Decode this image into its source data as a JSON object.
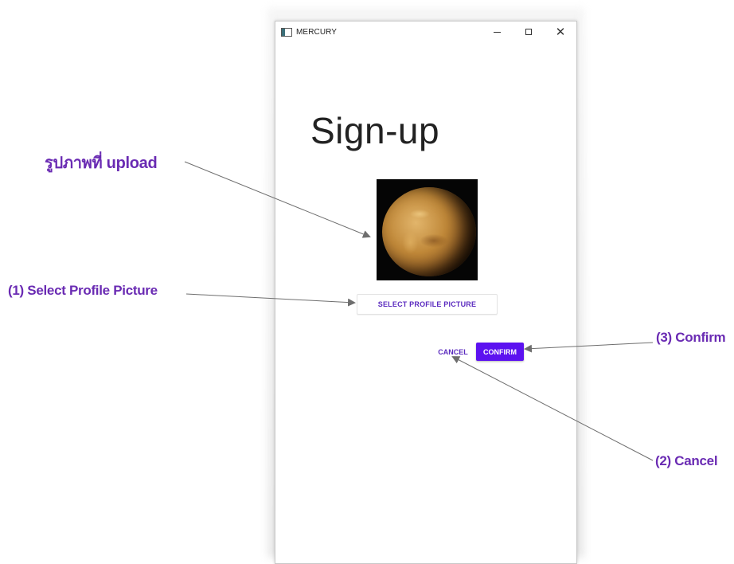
{
  "window": {
    "title": "MERCURY",
    "controls": [
      "minimize-icon",
      "maximize-icon",
      "close-icon"
    ],
    "close_glyph": "✕"
  },
  "form": {
    "heading": "Sign-up",
    "select_button": "SELECT PROFILE PICTURE",
    "cancel_button": "CANCEL",
    "confirm_button": "CONFIRM",
    "accent_color": "#5c12f0"
  },
  "annotations": {
    "uploaded_image": "รูปภาพที่ upload",
    "select": "(1) Select Profile Picture",
    "cancel": "(2) Cancel",
    "confirm": "(3) Confirm",
    "color": "#6a2bb3"
  }
}
